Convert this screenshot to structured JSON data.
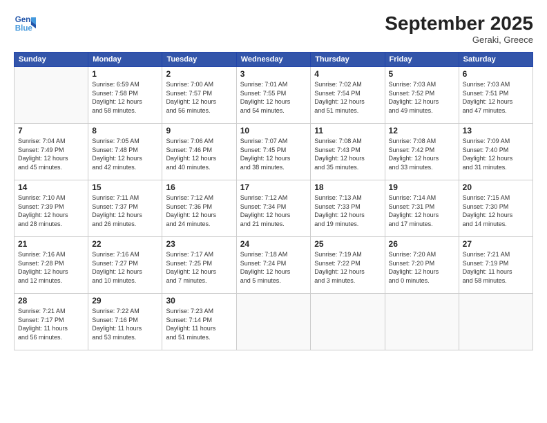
{
  "logo": {
    "line1": "General",
    "line2": "Blue"
  },
  "title": "September 2025",
  "location": "Geraki, Greece",
  "days_of_week": [
    "Sunday",
    "Monday",
    "Tuesday",
    "Wednesday",
    "Thursday",
    "Friday",
    "Saturday"
  ],
  "weeks": [
    [
      {
        "day": "",
        "info": ""
      },
      {
        "day": "1",
        "info": "Sunrise: 6:59 AM\nSunset: 7:58 PM\nDaylight: 12 hours\nand 58 minutes."
      },
      {
        "day": "2",
        "info": "Sunrise: 7:00 AM\nSunset: 7:57 PM\nDaylight: 12 hours\nand 56 minutes."
      },
      {
        "day": "3",
        "info": "Sunrise: 7:01 AM\nSunset: 7:55 PM\nDaylight: 12 hours\nand 54 minutes."
      },
      {
        "day": "4",
        "info": "Sunrise: 7:02 AM\nSunset: 7:54 PM\nDaylight: 12 hours\nand 51 minutes."
      },
      {
        "day": "5",
        "info": "Sunrise: 7:03 AM\nSunset: 7:52 PM\nDaylight: 12 hours\nand 49 minutes."
      },
      {
        "day": "6",
        "info": "Sunrise: 7:03 AM\nSunset: 7:51 PM\nDaylight: 12 hours\nand 47 minutes."
      }
    ],
    [
      {
        "day": "7",
        "info": "Sunrise: 7:04 AM\nSunset: 7:49 PM\nDaylight: 12 hours\nand 45 minutes."
      },
      {
        "day": "8",
        "info": "Sunrise: 7:05 AM\nSunset: 7:48 PM\nDaylight: 12 hours\nand 42 minutes."
      },
      {
        "day": "9",
        "info": "Sunrise: 7:06 AM\nSunset: 7:46 PM\nDaylight: 12 hours\nand 40 minutes."
      },
      {
        "day": "10",
        "info": "Sunrise: 7:07 AM\nSunset: 7:45 PM\nDaylight: 12 hours\nand 38 minutes."
      },
      {
        "day": "11",
        "info": "Sunrise: 7:08 AM\nSunset: 7:43 PM\nDaylight: 12 hours\nand 35 minutes."
      },
      {
        "day": "12",
        "info": "Sunrise: 7:08 AM\nSunset: 7:42 PM\nDaylight: 12 hours\nand 33 minutes."
      },
      {
        "day": "13",
        "info": "Sunrise: 7:09 AM\nSunset: 7:40 PM\nDaylight: 12 hours\nand 31 minutes."
      }
    ],
    [
      {
        "day": "14",
        "info": "Sunrise: 7:10 AM\nSunset: 7:39 PM\nDaylight: 12 hours\nand 28 minutes."
      },
      {
        "day": "15",
        "info": "Sunrise: 7:11 AM\nSunset: 7:37 PM\nDaylight: 12 hours\nand 26 minutes."
      },
      {
        "day": "16",
        "info": "Sunrise: 7:12 AM\nSunset: 7:36 PM\nDaylight: 12 hours\nand 24 minutes."
      },
      {
        "day": "17",
        "info": "Sunrise: 7:12 AM\nSunset: 7:34 PM\nDaylight: 12 hours\nand 21 minutes."
      },
      {
        "day": "18",
        "info": "Sunrise: 7:13 AM\nSunset: 7:33 PM\nDaylight: 12 hours\nand 19 minutes."
      },
      {
        "day": "19",
        "info": "Sunrise: 7:14 AM\nSunset: 7:31 PM\nDaylight: 12 hours\nand 17 minutes."
      },
      {
        "day": "20",
        "info": "Sunrise: 7:15 AM\nSunset: 7:30 PM\nDaylight: 12 hours\nand 14 minutes."
      }
    ],
    [
      {
        "day": "21",
        "info": "Sunrise: 7:16 AM\nSunset: 7:28 PM\nDaylight: 12 hours\nand 12 minutes."
      },
      {
        "day": "22",
        "info": "Sunrise: 7:16 AM\nSunset: 7:27 PM\nDaylight: 12 hours\nand 10 minutes."
      },
      {
        "day": "23",
        "info": "Sunrise: 7:17 AM\nSunset: 7:25 PM\nDaylight: 12 hours\nand 7 minutes."
      },
      {
        "day": "24",
        "info": "Sunrise: 7:18 AM\nSunset: 7:24 PM\nDaylight: 12 hours\nand 5 minutes."
      },
      {
        "day": "25",
        "info": "Sunrise: 7:19 AM\nSunset: 7:22 PM\nDaylight: 12 hours\nand 3 minutes."
      },
      {
        "day": "26",
        "info": "Sunrise: 7:20 AM\nSunset: 7:20 PM\nDaylight: 12 hours\nand 0 minutes."
      },
      {
        "day": "27",
        "info": "Sunrise: 7:21 AM\nSunset: 7:19 PM\nDaylight: 11 hours\nand 58 minutes."
      }
    ],
    [
      {
        "day": "28",
        "info": "Sunrise: 7:21 AM\nSunset: 7:17 PM\nDaylight: 11 hours\nand 56 minutes."
      },
      {
        "day": "29",
        "info": "Sunrise: 7:22 AM\nSunset: 7:16 PM\nDaylight: 11 hours\nand 53 minutes."
      },
      {
        "day": "30",
        "info": "Sunrise: 7:23 AM\nSunset: 7:14 PM\nDaylight: 11 hours\nand 51 minutes."
      },
      {
        "day": "",
        "info": ""
      },
      {
        "day": "",
        "info": ""
      },
      {
        "day": "",
        "info": ""
      },
      {
        "day": "",
        "info": ""
      }
    ]
  ]
}
